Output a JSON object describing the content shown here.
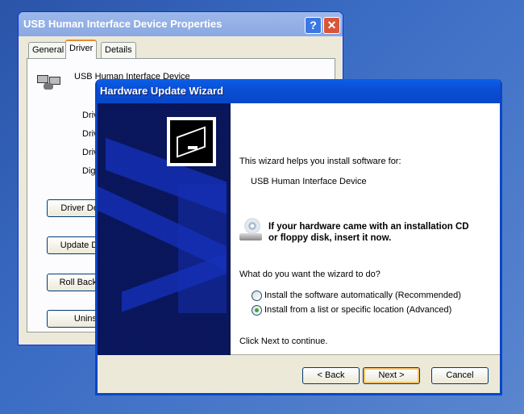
{
  "props": {
    "title": "USB Human Interface Device Properties",
    "help": "?",
    "close": "✕",
    "tabs": [
      "General",
      "Driver",
      "Details"
    ],
    "device_name": "USB Human Interface Device",
    "labels": [
      "Driver",
      "Driver",
      "Driver",
      "Digita"
    ],
    "buttons": [
      "Driver Details...",
      "Update Driver...",
      "Roll Back Driver",
      "Uninstall"
    ]
  },
  "wizard": {
    "title": "Hardware Update Wizard",
    "intro": "This wizard helps you install software for:",
    "device": "USB Human Interface Device",
    "cd_line1": "If your hardware came with an installation CD",
    "cd_line2": "or floppy disk, insert it now.",
    "question": "What do you want the wizard to do?",
    "options": [
      {
        "label": "Install the software automatically (Recommended)",
        "selected": false
      },
      {
        "label": "Install from a list or specific location (Advanced)",
        "selected": true
      }
    ],
    "continue": "Click Next to continue.",
    "back": "< Back",
    "next": "Next >",
    "cancel": "Cancel"
  }
}
